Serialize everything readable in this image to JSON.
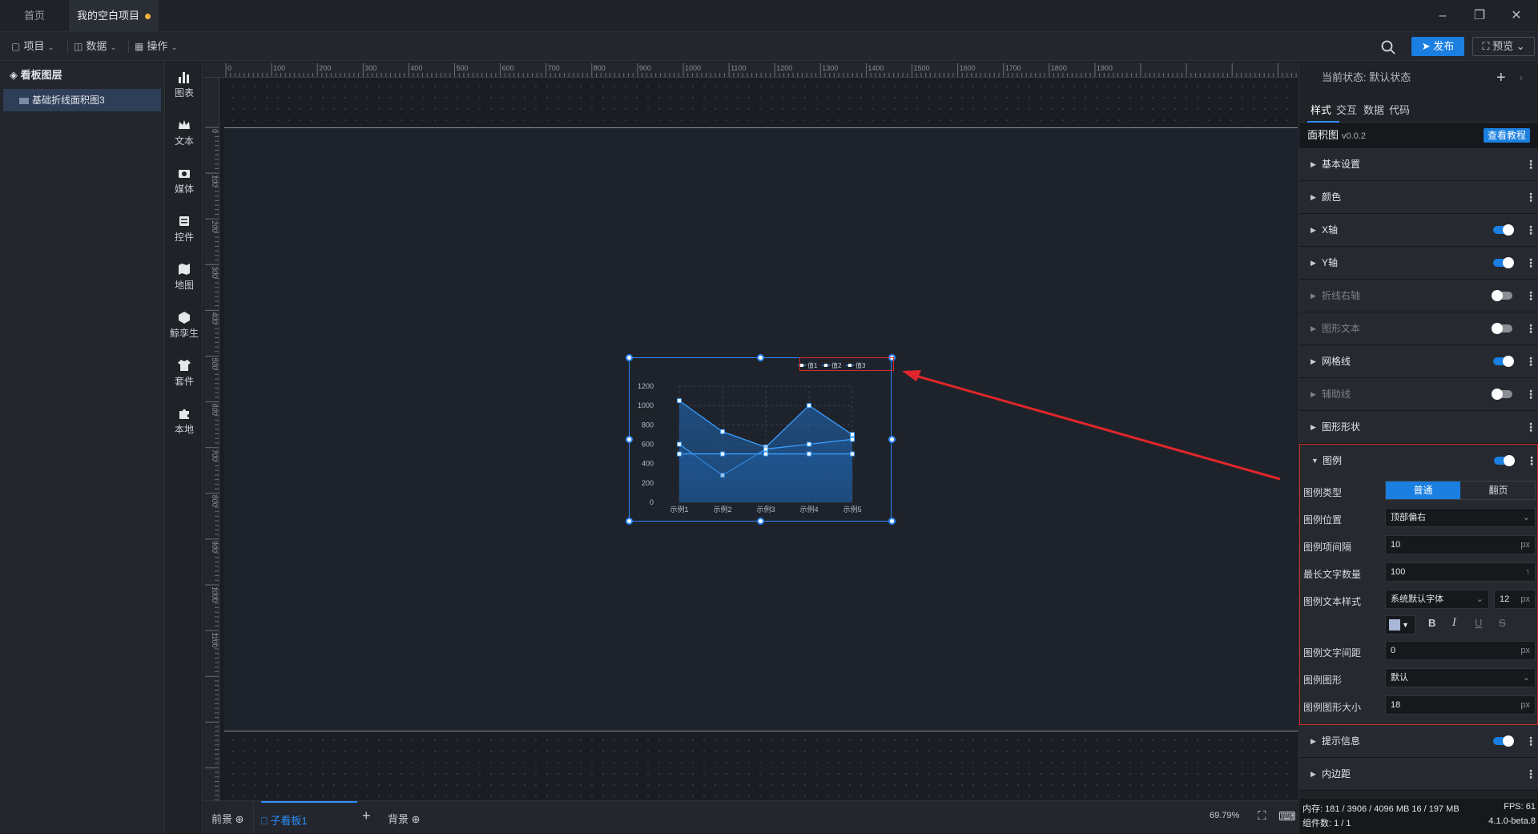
{
  "tabs": {
    "home": "首页",
    "project": "我的空白项目"
  },
  "menu": {
    "project": "项目",
    "data": "数据",
    "ops": "操作",
    "publish": "发布",
    "preview": "预览"
  },
  "layers": {
    "title": "看板图层",
    "item": "基础折线面积图3"
  },
  "tools": [
    "图表",
    "文本",
    "媒体",
    "控件",
    "地图",
    "鲸孪生",
    "套件",
    "本地"
  ],
  "ruler": {
    "h": [
      "0",
      "100",
      "200",
      "300",
      "400",
      "500",
      "600",
      "700",
      "800",
      "900",
      "1000",
      "1100",
      "1200",
      "1300",
      "1400",
      "1500",
      "1600",
      "1700",
      "1800",
      "1900"
    ],
    "v": [
      "0",
      "100",
      "200",
      "300",
      "400",
      "500",
      "600",
      "700",
      "800",
      "900",
      "1000",
      "1100"
    ]
  },
  "chart_data": {
    "type": "area",
    "categories": [
      "示例1",
      "示例2",
      "示例3",
      "示例4",
      "示例5"
    ],
    "series": [
      {
        "name": "值1",
        "values": [
          1050,
          730,
          570,
          1000,
          700
        ]
      },
      {
        "name": "值2",
        "values": [
          600,
          280,
          550,
          600,
          650
        ]
      },
      {
        "name": "值3",
        "values": [
          500,
          500,
          500,
          500,
          500
        ]
      }
    ],
    "yticks": [
      "0",
      "200",
      "400",
      "600",
      "800",
      "1000",
      "1200"
    ],
    "ylim": [
      0,
      1200
    ],
    "legend_position": "top-right",
    "grid": true,
    "colors": {
      "line": "#3a9cff",
      "area": "#1f5a9a"
    }
  },
  "bottom": {
    "front": "前景",
    "board": "子看板1",
    "bg": "背景",
    "zoom": "69.79%"
  },
  "panel": {
    "state_label": "当前状态:",
    "state_value": "默认状态",
    "tabs": [
      "样式",
      "交互",
      "数据",
      "代码"
    ],
    "comp_name": "面积图",
    "comp_ver": "v0.0.2",
    "tutorial": "查看教程",
    "sections": [
      {
        "label": "基本设置"
      },
      {
        "label": "颜色"
      },
      {
        "label": "X轴"
      },
      {
        "label": "Y轴"
      },
      {
        "label": "折线右轴"
      },
      {
        "label": "图形文本"
      },
      {
        "label": "网格线"
      },
      {
        "label": "辅助线"
      },
      {
        "label": "图形形状"
      }
    ],
    "legend": {
      "title": "图例",
      "type_label": "图例类型",
      "type_a": "普通",
      "type_b": "翻页",
      "pos_label": "图例位置",
      "pos_value": "顶部偏右",
      "gap_label": "图例项间隔",
      "gap_value": "10",
      "max_label": "最长文字数量",
      "max_value": "100",
      "font_label": "图例文本样式",
      "font_value": "系统默认字体",
      "font_size": "12",
      "spacing_label": "图例文字间距",
      "spacing_value": "0",
      "shape_label": "图例图形",
      "shape_value": "默认",
      "shape_size_label": "图例图形大小",
      "shape_size_value": "18",
      "unit": "px"
    },
    "after": [
      {
        "label": "提示信息"
      },
      {
        "label": "内边距"
      }
    ],
    "status": {
      "mem": "内存:",
      "mem_value": "181 / 3906 / 4096 MB  16 / 197 MB",
      "fps_label": "FPS:",
      "fps_value": "61",
      "count": "组件数: 1 / 1",
      "version": "4.1.0-beta.8"
    }
  }
}
